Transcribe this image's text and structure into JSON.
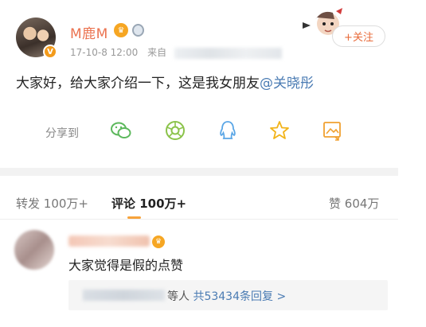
{
  "post": {
    "username": "M鹿M",
    "vip_badge": "V",
    "date": "17-10-8 12:00",
    "source_prefix": "来自",
    "follow_label": "+关注",
    "text": "大家好，给大家介绍一下，这是我女朋友",
    "mention": "@关晓彤",
    "share_label": "分享到",
    "share_icons": [
      "wechat-icon",
      "moments-icon",
      "qq-icon",
      "qzone-icon",
      "screenshot-icon"
    ]
  },
  "tabs": [
    {
      "label": "转发",
      "count": "100万+"
    },
    {
      "label": "评论",
      "count": "100万+",
      "active": true
    },
    {
      "label": "赞",
      "count": "604万"
    }
  ],
  "comment": {
    "text": "大家觉得是假的点赞",
    "reply_suffix": "等人",
    "reply_count": "共53434条回复 >"
  },
  "colors": {
    "username": "#eb7350",
    "mention": "#4a7bb3",
    "accent": "#f7a33b"
  }
}
